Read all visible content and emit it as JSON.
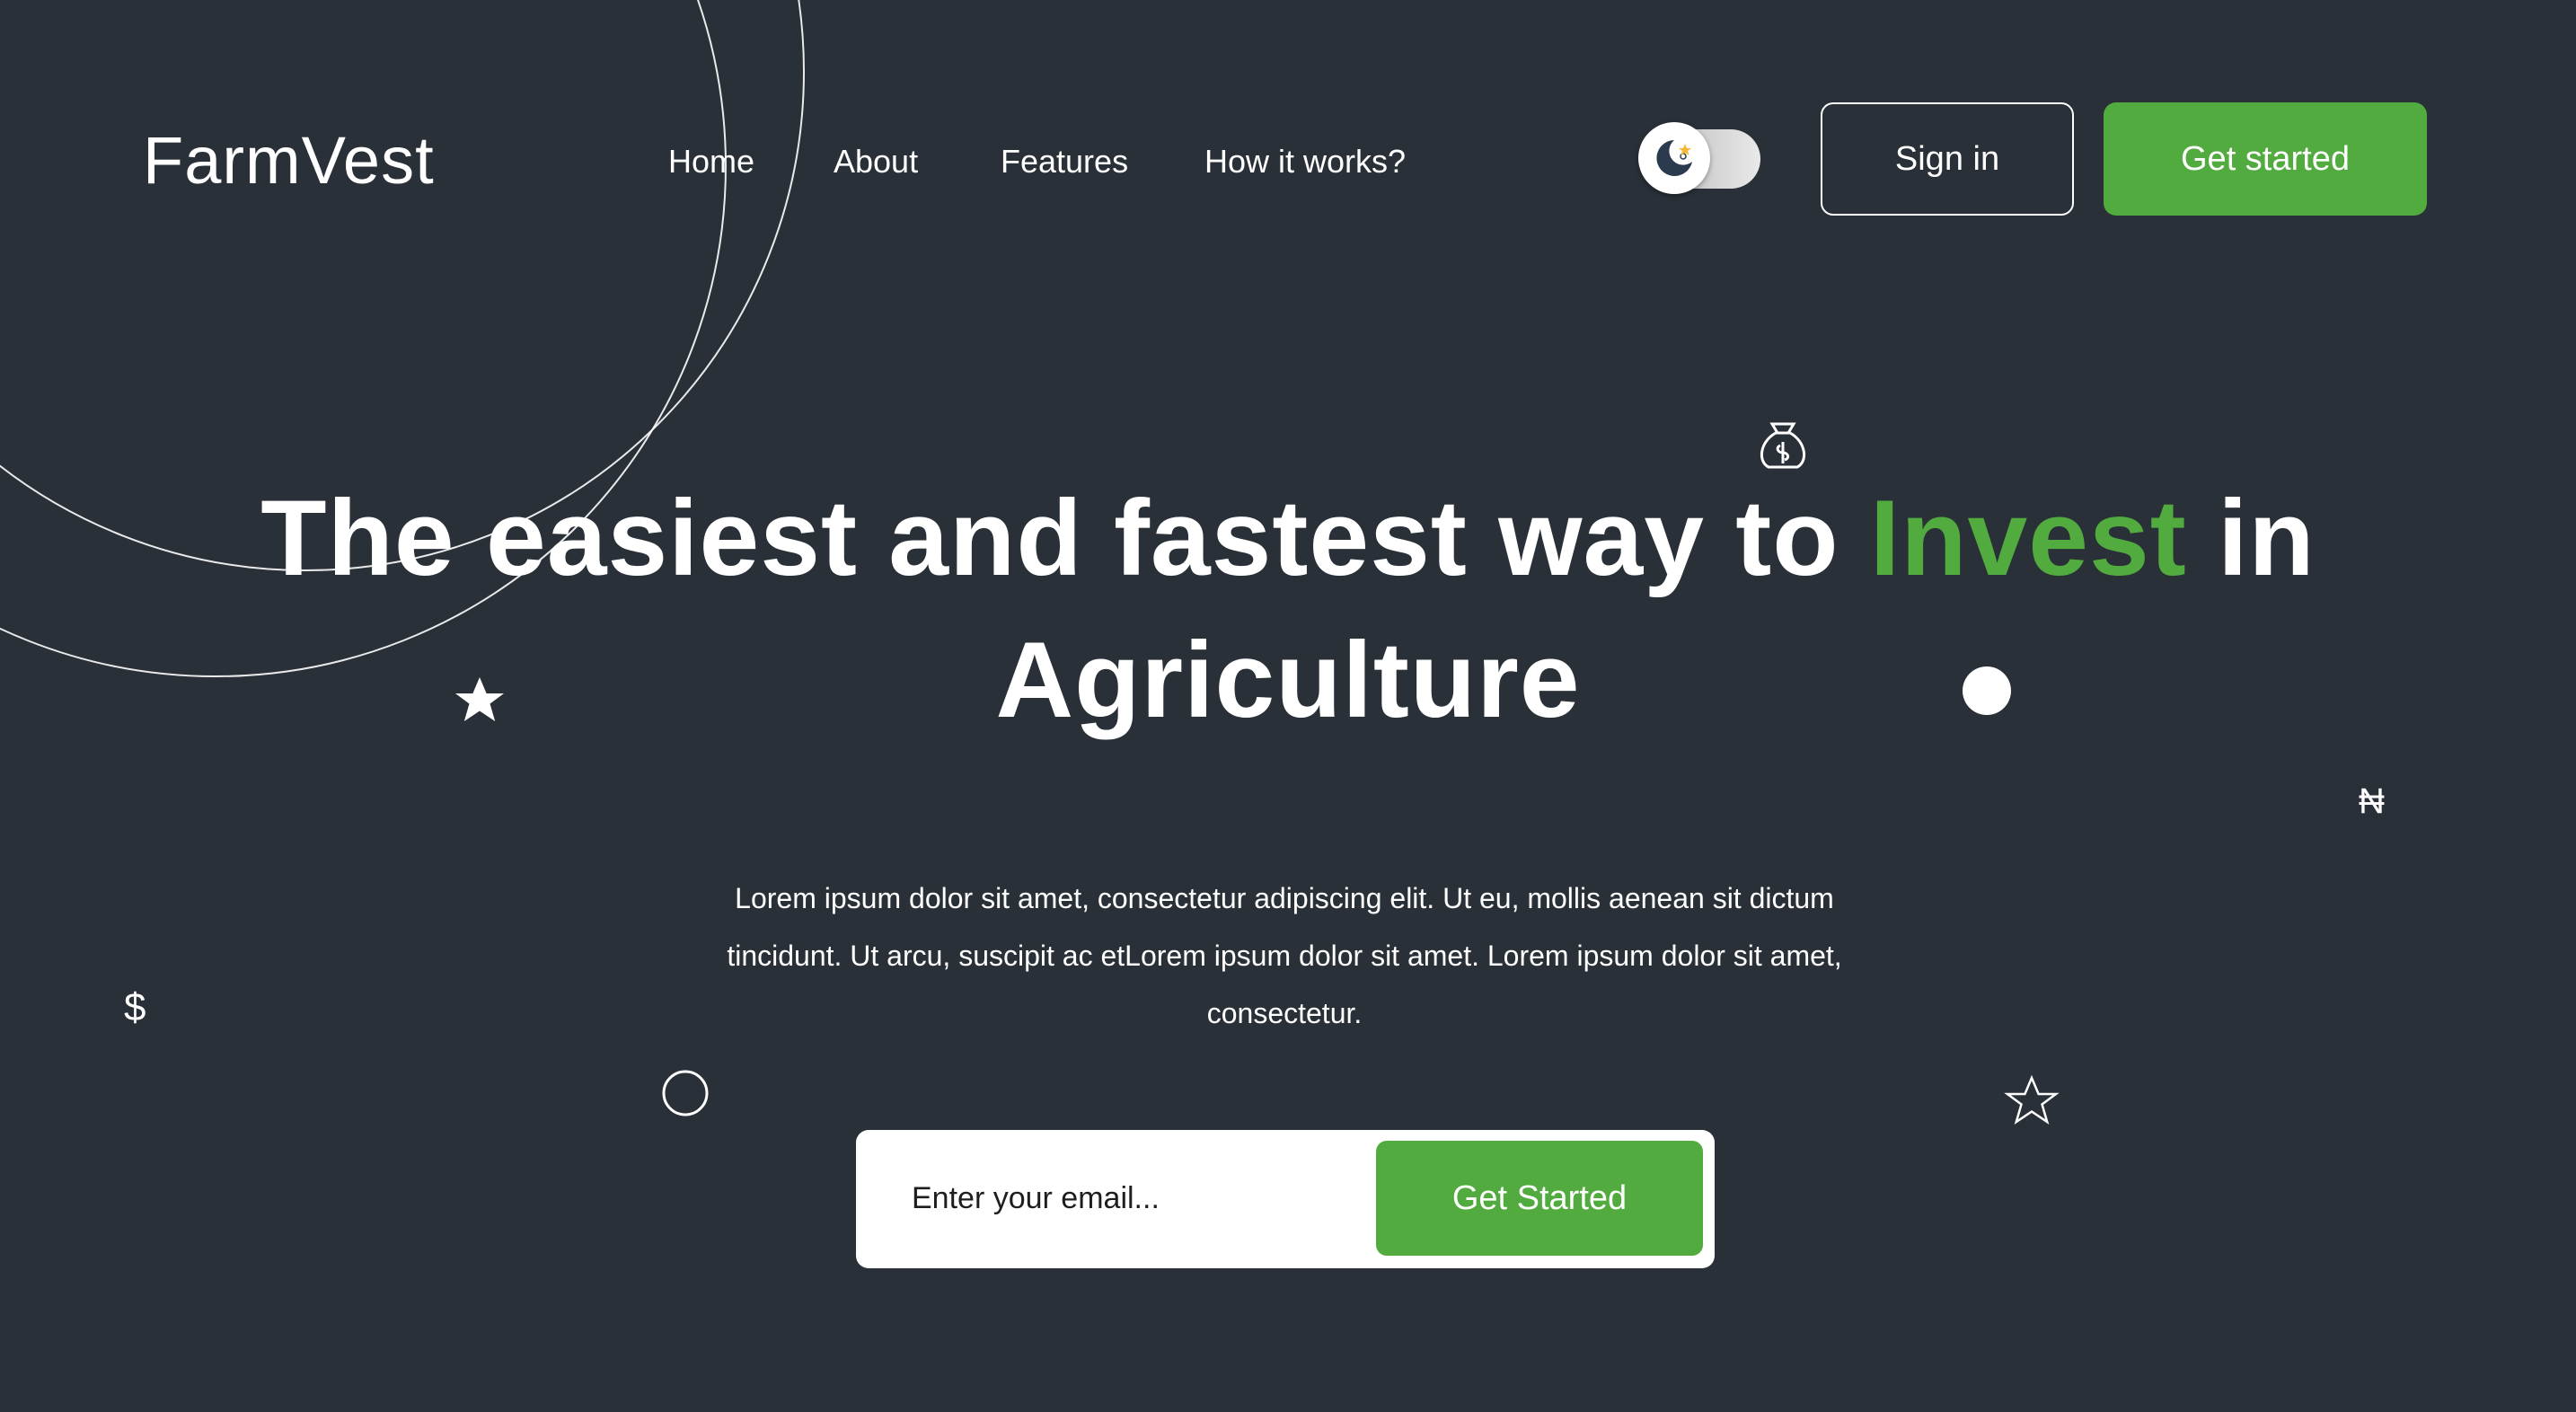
{
  "brand": {
    "name": "FarmVest"
  },
  "nav": {
    "items": [
      {
        "label": "Home"
      },
      {
        "label": "About"
      },
      {
        "label": "Features"
      },
      {
        "label": "How it works?"
      }
    ]
  },
  "header": {
    "theme_toggle_icon": "moon-star-icon",
    "signin_label": "Sign in",
    "getstarted_label": "Get started"
  },
  "hero": {
    "title_part1": "The easiest and fastest way to ",
    "title_accent": "Invest",
    "title_part2": " in Agriculture",
    "description": "Lorem ipsum dolor sit amet, consectetur adipiscing elit. Ut eu, mollis aenean sit dictum tincidunt. Ut arcu, suscipit ac etLorem ipsum dolor sit amet. Lorem ipsum dolor sit amet, consectetur.",
    "email_placeholder": "Enter your email...",
    "cta_label": "Get Started"
  },
  "decorations": {
    "dollar_symbol": "$",
    "naira_symbol": "₦",
    "icons": [
      "money-bag-icon",
      "filled-star-icon",
      "outline-star-icon",
      "filled-circle-icon",
      "outline-circle-icon",
      "outline-circle-arcs"
    ]
  },
  "colors": {
    "background": "#293038",
    "accent": "#52ab3e",
    "text": "#ffffff",
    "input_bg": "#ffffff"
  }
}
